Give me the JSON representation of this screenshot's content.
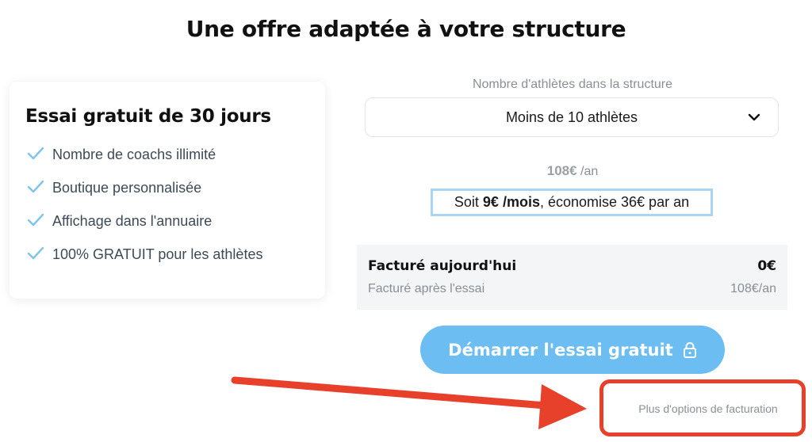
{
  "page": {
    "title": "Une offre adaptée à votre structure"
  },
  "trial": {
    "title": "Essai gratuit de 30 jours",
    "features": [
      "Nombre de coachs illimité",
      "Boutique personnalisée",
      "Affichage dans l'annuaire",
      "100% GRATUIT pour les athlètes"
    ],
    "check_icon": "check-icon"
  },
  "athletes": {
    "label": "Nombre d'athlètes dans la structure",
    "selected": "Moins de 10 athlètes"
  },
  "pricing": {
    "amount": "108€",
    "period": " /an",
    "monthly_prefix": "Soit ",
    "monthly_amount": "9€ /mois",
    "monthly_suffix": ", économise 36€ par an"
  },
  "billing": {
    "today_label": "Facturé aujourd'hui",
    "today_value": "0€",
    "after_label": "Facturé après l'essai",
    "after_value": "108€/an"
  },
  "cta": {
    "label": "Démarrer l'essai gratuit"
  },
  "more_options": {
    "label": "Plus d'options de facturation"
  },
  "colors": {
    "accent": "#6cbdf1",
    "check": "#7fc3ee",
    "annotation": "#e8412b",
    "panel": "#f3f5f7"
  }
}
